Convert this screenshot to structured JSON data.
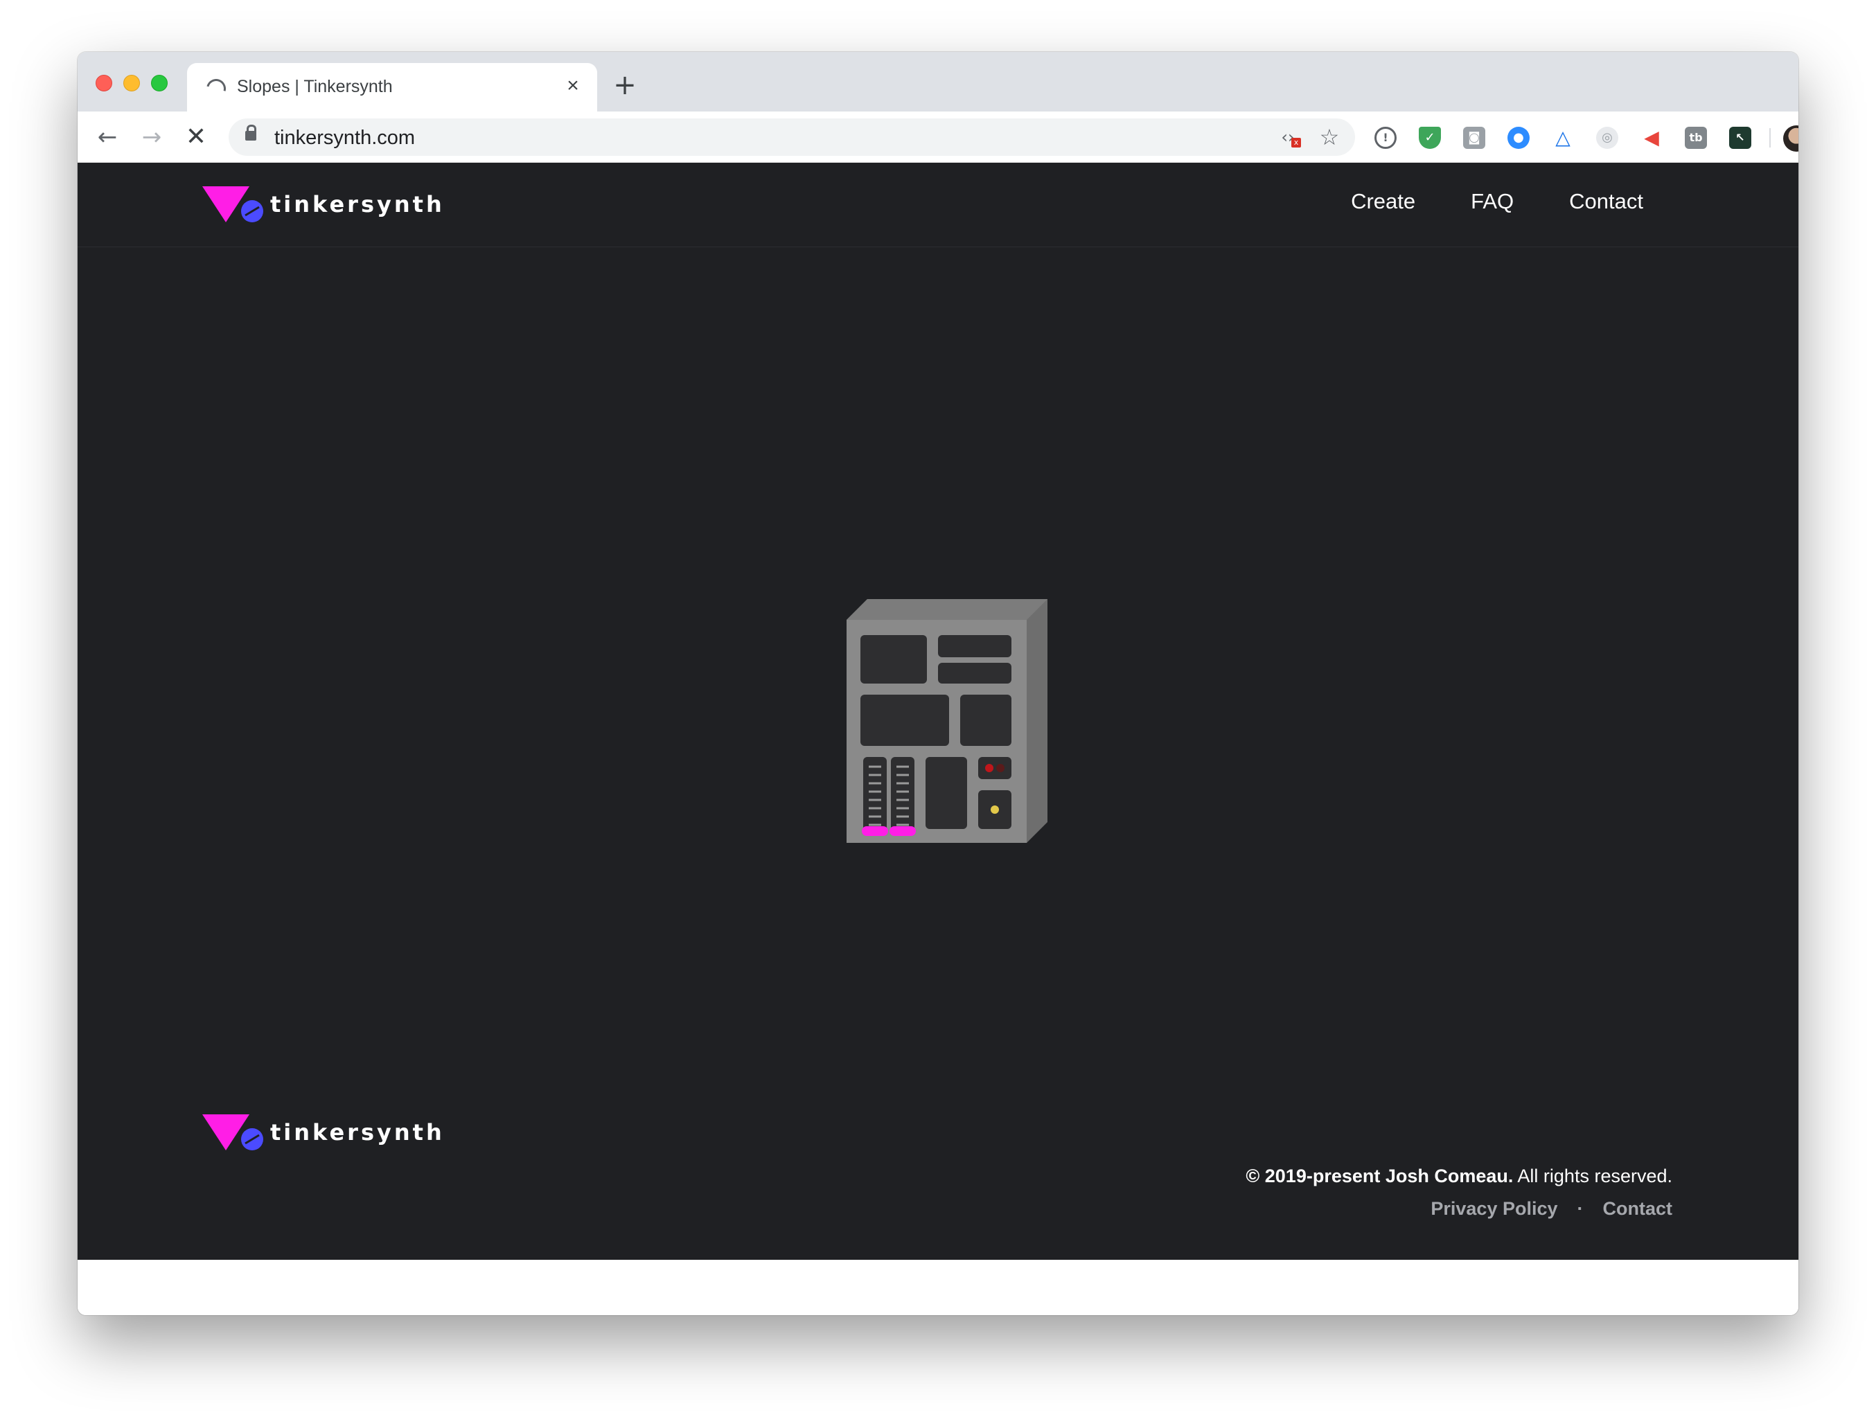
{
  "browser": {
    "tab_title": "Slopes | Tinkersynth",
    "tab_close": "×",
    "new_tab": "+",
    "url": "tinkersynth.com",
    "back": "←",
    "forward": "→",
    "stop": "✕",
    "icons": {
      "code": "‹›",
      "star": "☆",
      "kebab": "⋮"
    },
    "extensions": [
      "info-ext-icon",
      "shield-ext-icon",
      "camera-ext-icon",
      "zoom-ext-icon",
      "triangle-ext-icon",
      "wheel-ext-icon",
      "megaphone-ext-icon",
      "tb-ext-icon",
      "cursor-ext-icon"
    ],
    "ext_glyphs": [
      "!",
      "✓",
      "◙",
      "●",
      "△",
      "◎",
      "📢",
      "tb",
      "↖"
    ]
  },
  "header": {
    "brand": "tinkersynth",
    "nav": [
      "Create",
      "FAQ",
      "Contact"
    ]
  },
  "footer": {
    "brand": "tinkersynth",
    "copyright_bold": "© 2019-present Josh Comeau.",
    "copyright_rest": " All rights reserved.",
    "separator": "·",
    "links": [
      "Privacy Policy",
      "Contact"
    ]
  },
  "colors": {
    "page_bg": "#1f2023",
    "logo_magenta": "#ff1ee6",
    "logo_blue": "#4b4bff",
    "machine_gray": "#8a8a8a"
  }
}
